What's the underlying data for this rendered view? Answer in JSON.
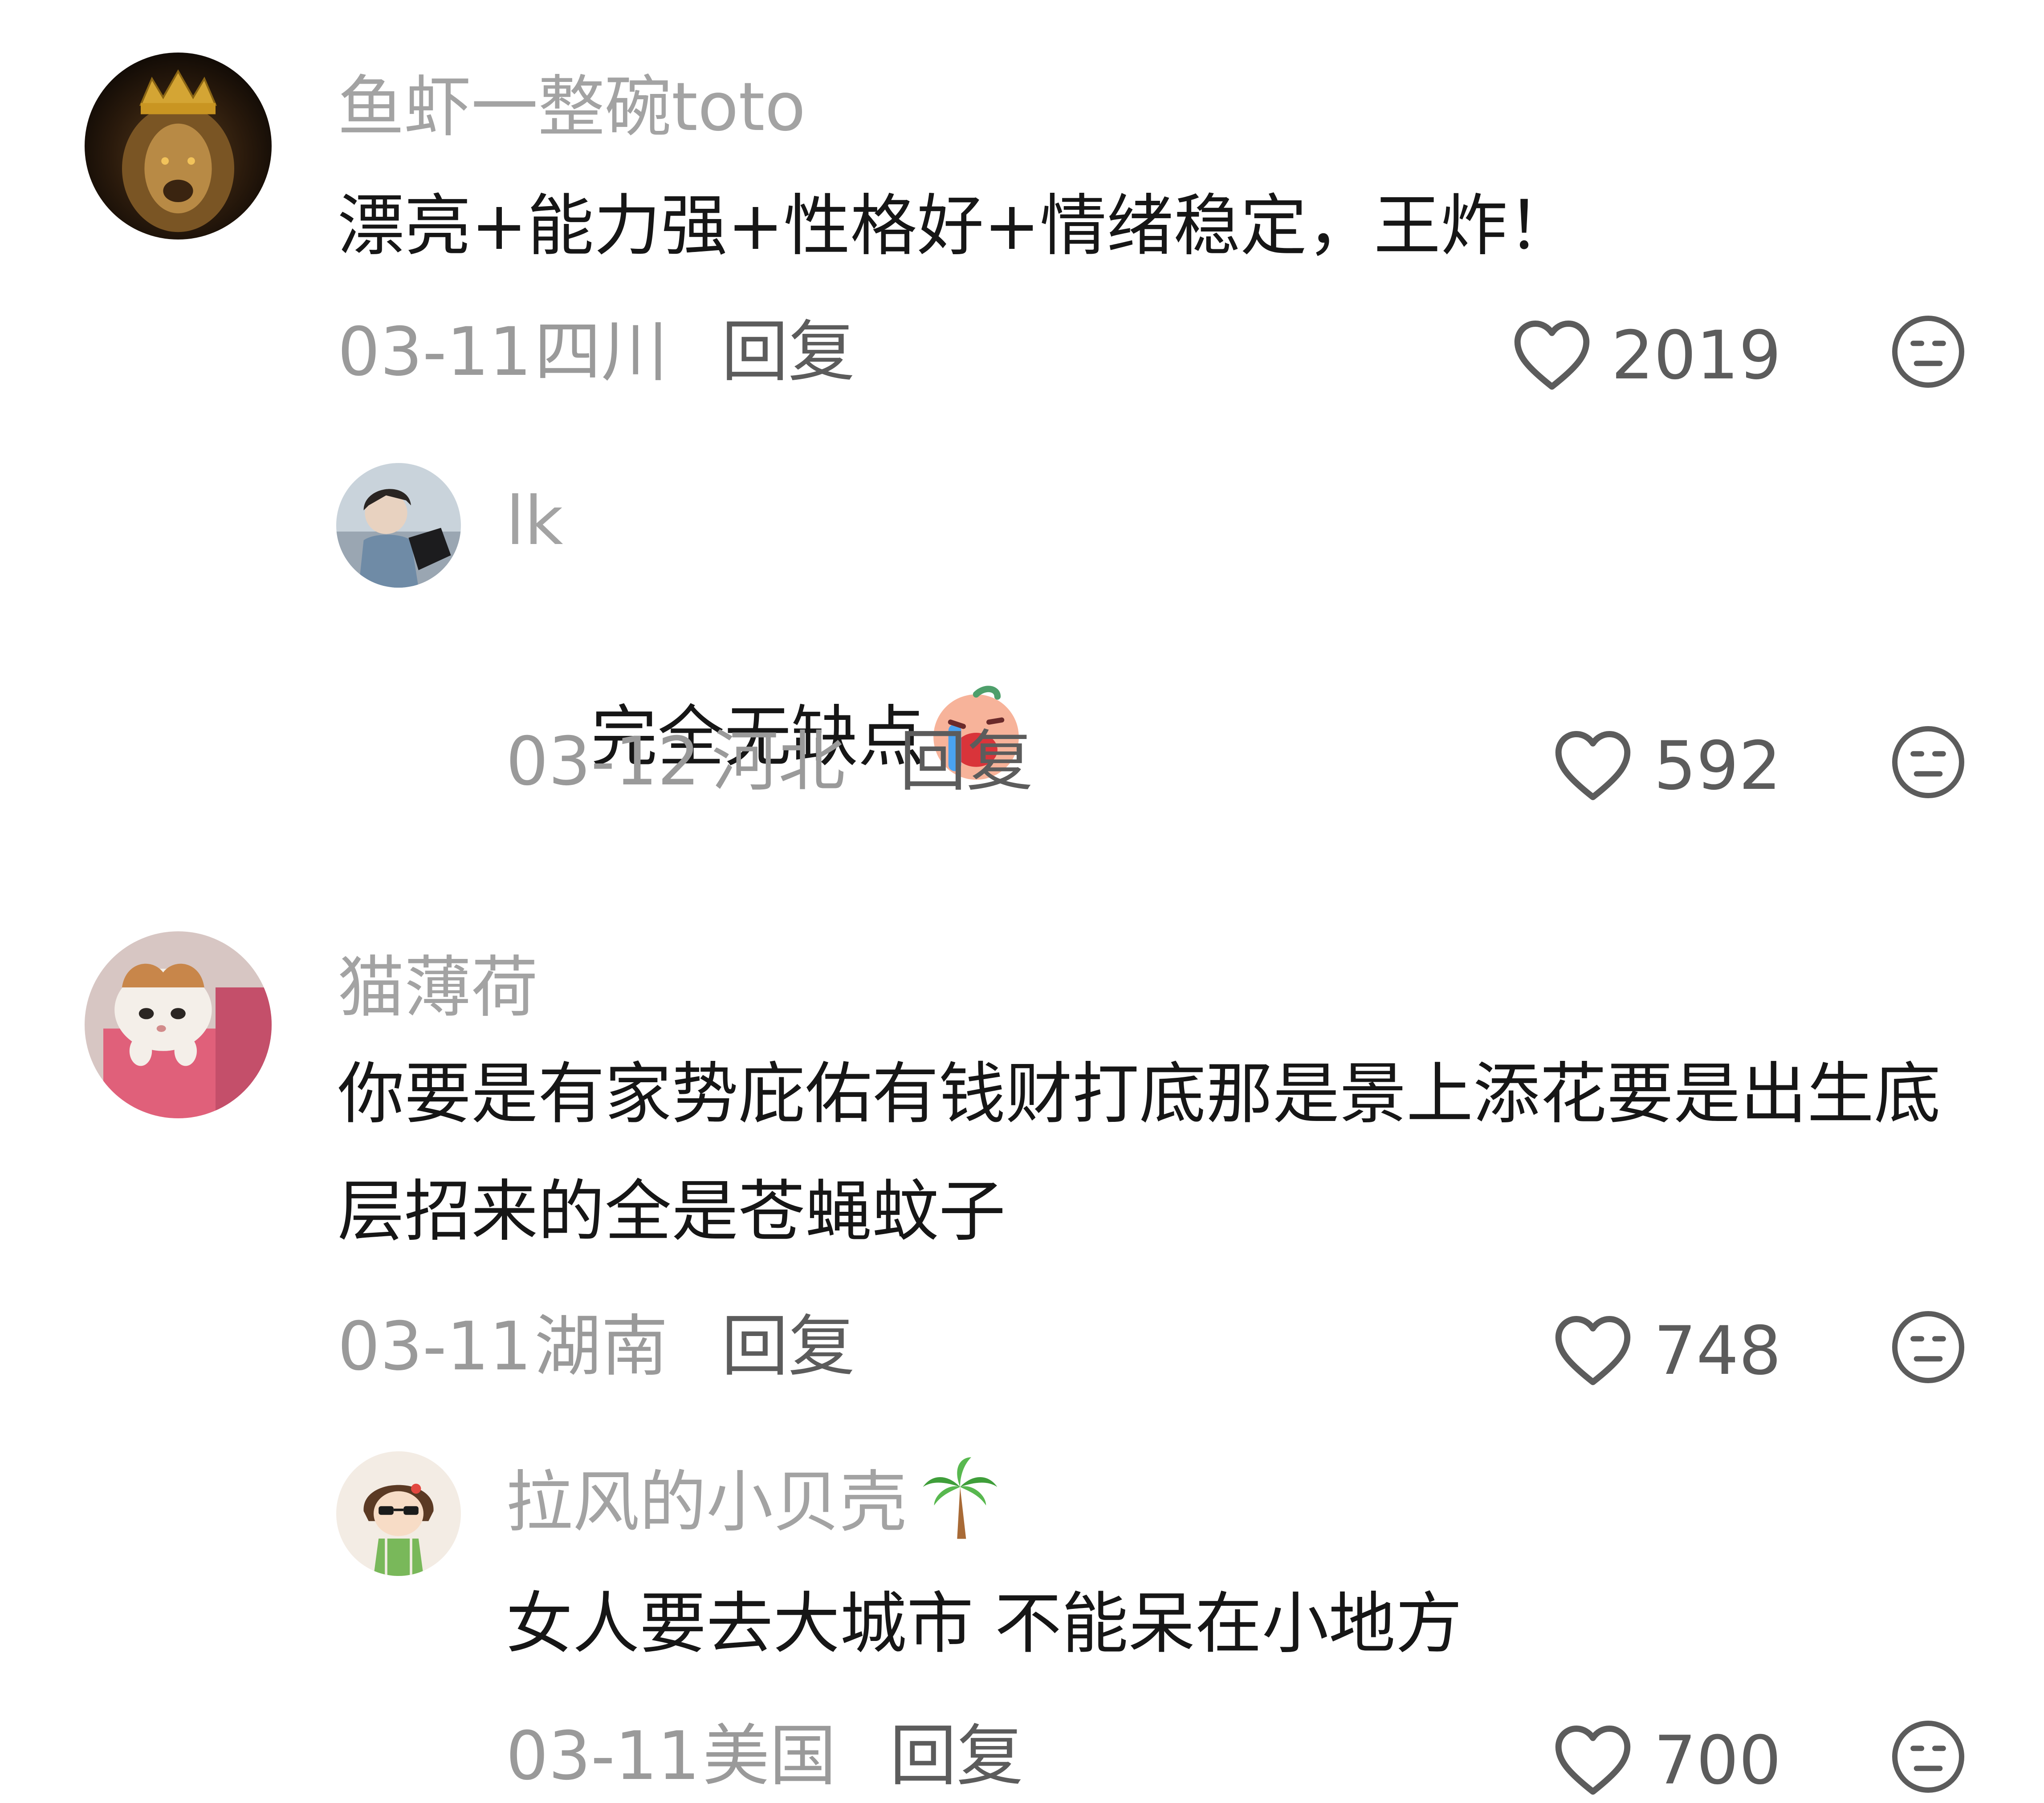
{
  "comments": [
    {
      "username": "鱼虾一整碗toto",
      "text": "漂亮+能力强+性格好+情绪稳定，王炸！",
      "date": "03-11",
      "location": "四川",
      "reply_label": "回复",
      "likes": "2019",
      "avatar": "lion-avatar"
    },
    {
      "username": "lk",
      "text": "完全无缺点",
      "emoji": "crying-emoji",
      "date": "03-12",
      "location": "河北",
      "reply_label": "回复",
      "likes": "592",
      "avatar": "person-avatar"
    },
    {
      "username": "猫薄荷",
      "text": "你要是有家势庇佑有钱财打底那是景上添花要是出生底层招来的全是苍蝇蚊子",
      "date": "03-11",
      "location": "湖南",
      "reply_label": "回复",
      "likes": "748",
      "avatar": "cat-avatar"
    },
    {
      "username": "拉风的小贝壳",
      "username_emoji": "palm-tree-emoji",
      "text": "女人要去大城市 不能呆在小地方",
      "date": "03-11",
      "location": "美国",
      "reply_label": "回复",
      "likes": "700",
      "avatar": "cartoon-girl-avatar"
    }
  ],
  "icons": {
    "like": "heart-outline-icon",
    "dislike": "neutral-face-icon"
  },
  "colors": {
    "username": "#a3a3a3",
    "text": "#161616",
    "meta": "#9a9a9a",
    "action": "#5c5c5c"
  }
}
